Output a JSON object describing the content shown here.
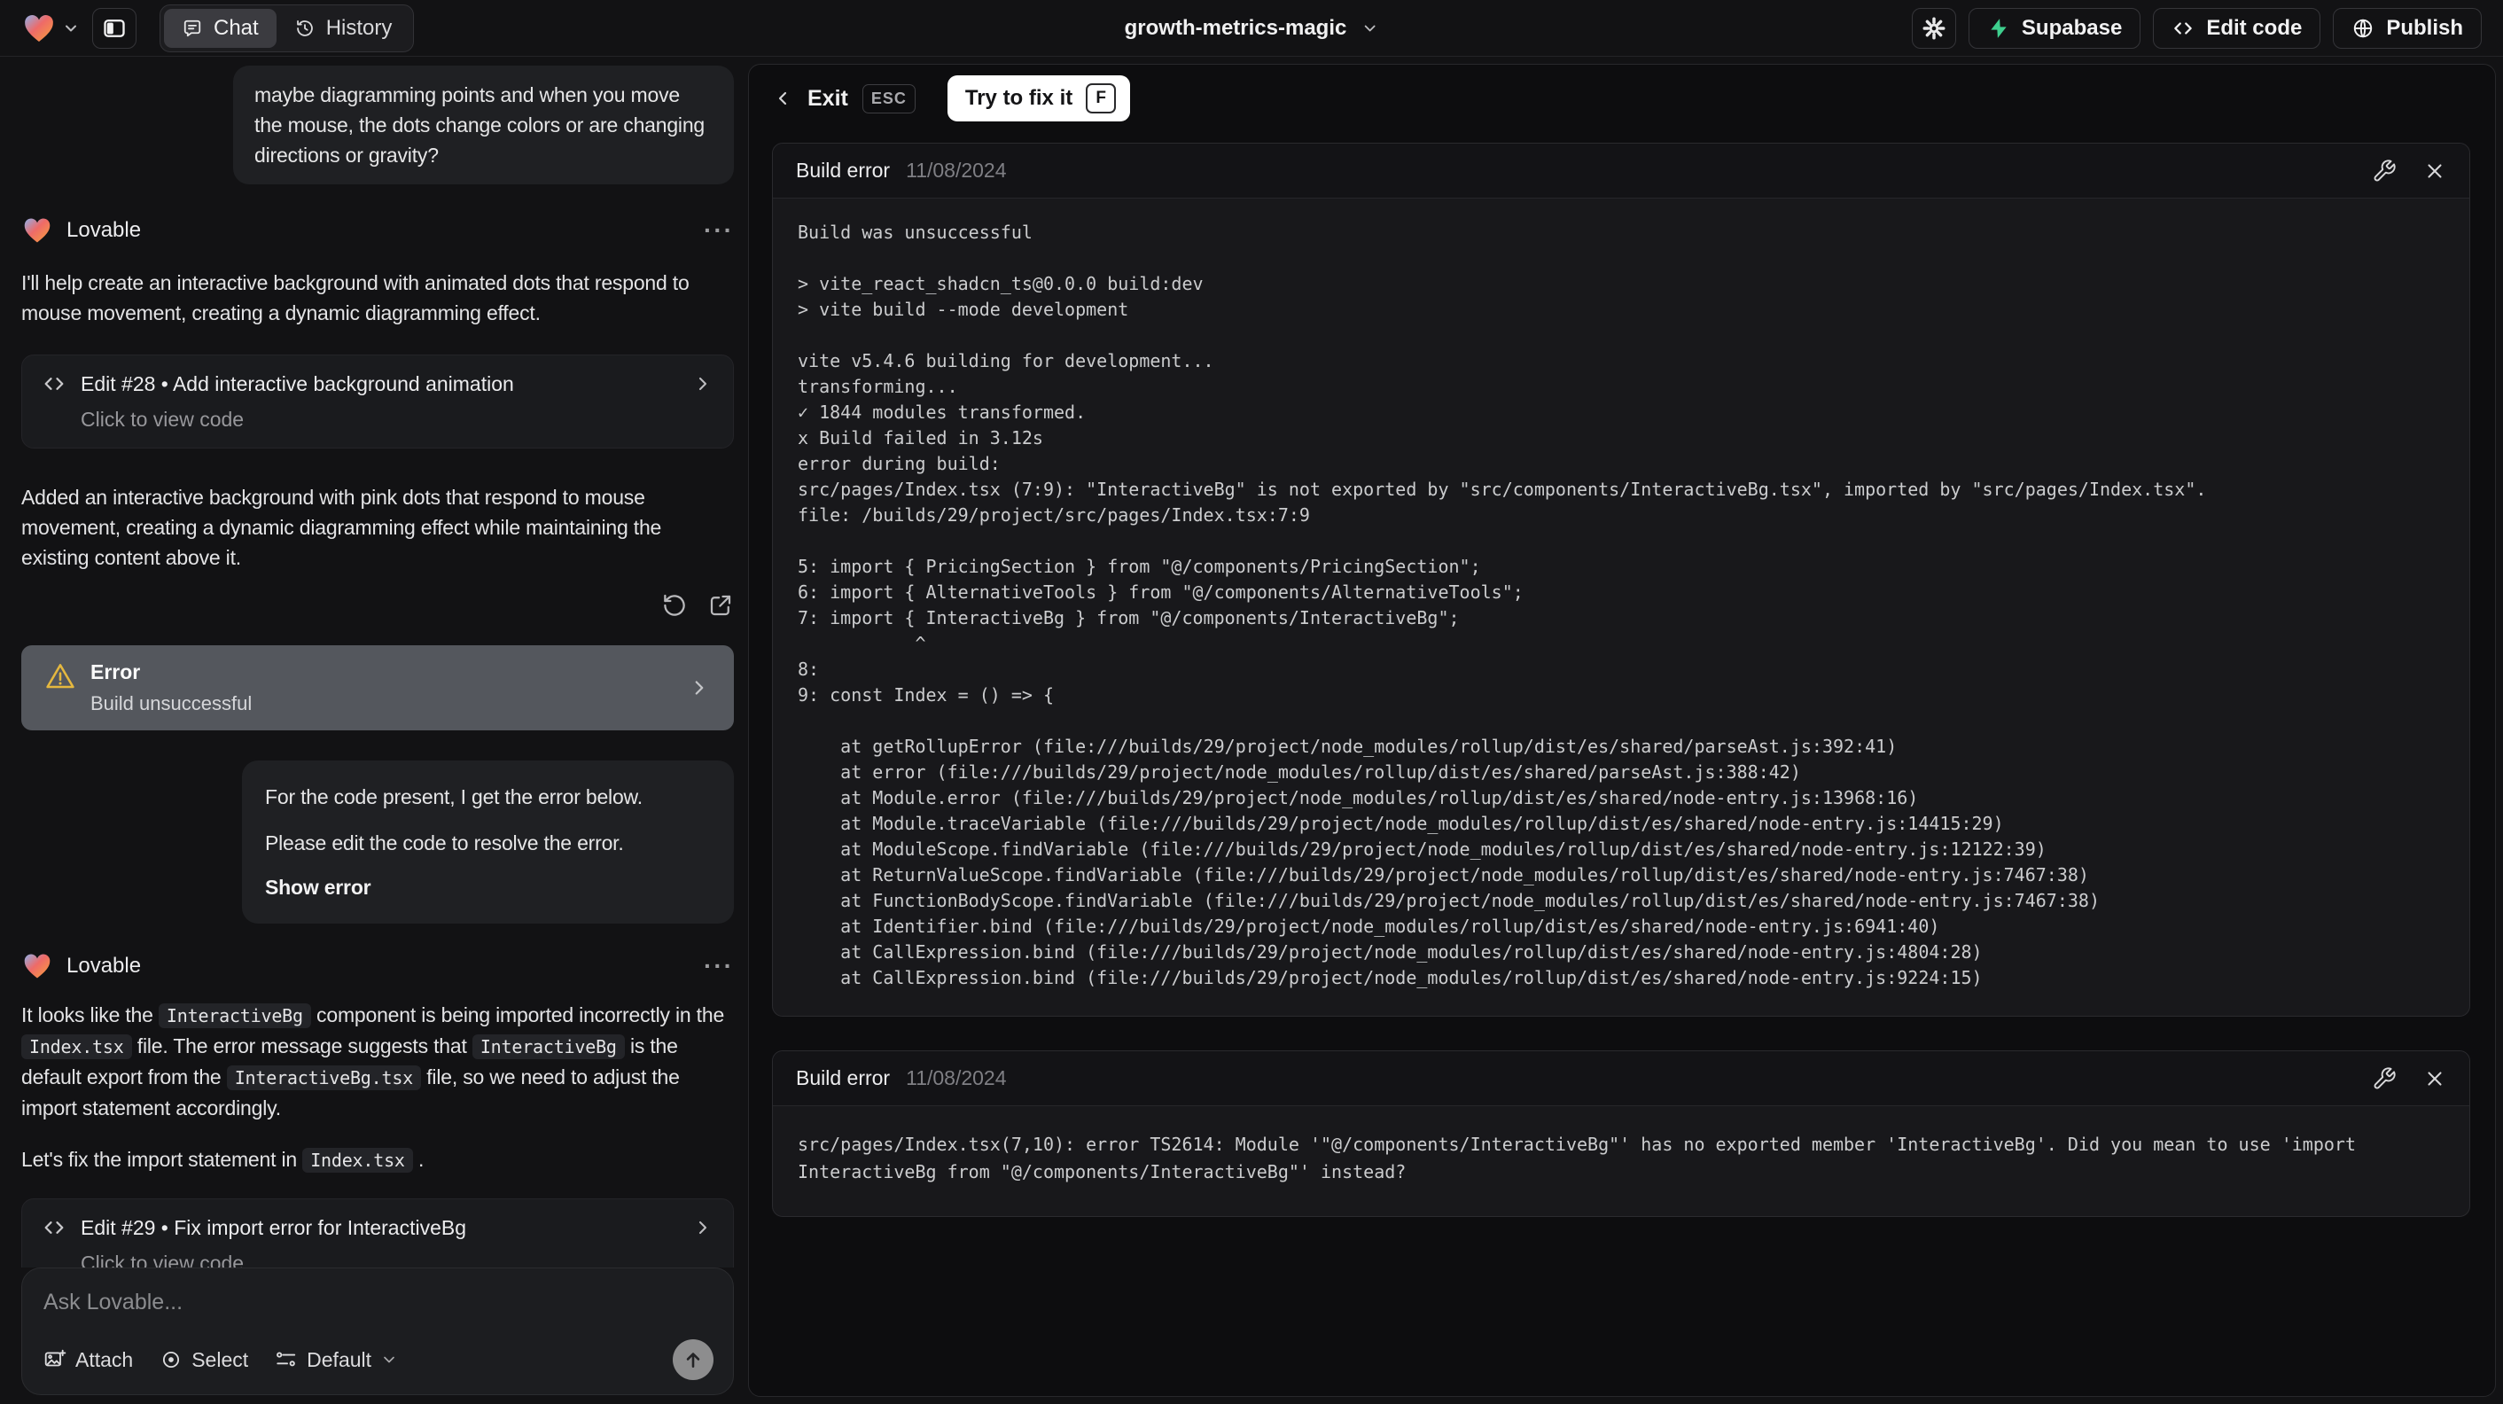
{
  "topbar": {
    "tabs": {
      "chat": "Chat",
      "history": "History"
    },
    "project_name": "growth-metrics-magic",
    "supabase_label": "Supabase",
    "edit_code_label": "Edit code",
    "publish_label": "Publish"
  },
  "ui": {
    "more_glyph": "···"
  },
  "chat": {
    "assistant_name": "Lovable",
    "user_msg1": "maybe diagramming points and when you move the mouse, the dots change colors or are changing directions or gravity?",
    "reply1_p1": "I'll help create an interactive background with animated dots that respond to mouse movement, creating a dynamic diagramming effect.",
    "edit28": {
      "title": "Edit #28 • Add interactive background animation",
      "subtitle": "Click to view code"
    },
    "reply1_p2": "Added an interactive background with pink dots that respond to mouse movement, creating a dynamic diagramming effect while maintaining the existing content above it.",
    "error_status": {
      "title": "Error",
      "subtitle": "Build unsuccessful"
    },
    "user_msg2": {
      "line1": "For the code present, I get the error below.",
      "line2": "Please edit the code to resolve the error.",
      "action": "Show error"
    },
    "reply2": {
      "s0": "It looks like the ",
      "c0": "InteractiveBg",
      "s1": " component is being imported incorrectly in the ",
      "c1": "Index.tsx",
      "s2": " file. The error message suggests that ",
      "c2": "InteractiveBg",
      "s3": " is the default export from the ",
      "c3": "InteractiveBg.tsx",
      "s4": " file, so we need to adjust the import statement accordingly."
    },
    "reply2b": {
      "s0": "Let's fix the import statement in ",
      "c0": "Index.tsx",
      "s1": " ."
    },
    "edit29": {
      "title": "Edit #29 • Fix import error for InteractiveBg",
      "subtitle": "Click to view code"
    },
    "composer": {
      "placeholder": "Ask Lovable...",
      "attach_label": "Attach",
      "select_label": "Select",
      "model_label": "Default"
    }
  },
  "preview": {
    "exit_label": "Exit",
    "esc_label": "ESC",
    "fix_label": "Try to fix it",
    "fix_key": "F",
    "errors": [
      {
        "title": "Build error",
        "date": "11/08/2024",
        "log": "Build was unsuccessful\n\n> vite_react_shadcn_ts@0.0.0 build:dev\n> vite build --mode development\n\nvite v5.4.6 building for development...\ntransforming...\n✓ 1844 modules transformed.\nx Build failed in 3.12s\nerror during build:\nsrc/pages/Index.tsx (7:9): \"InteractiveBg\" is not exported by \"src/components/InteractiveBg.tsx\", imported by \"src/pages/Index.tsx\".\nfile: /builds/29/project/src/pages/Index.tsx:7:9\n\n5: import { PricingSection } from \"@/components/PricingSection\";\n6: import { AlternativeTools } from \"@/components/AlternativeTools\";\n7: import { InteractiveBg } from \"@/components/InteractiveBg\";\n           ^\n8:\n9: const Index = () => {\n\n    at getRollupError (file:///builds/29/project/node_modules/rollup/dist/es/shared/parseAst.js:392:41)\n    at error (file:///builds/29/project/node_modules/rollup/dist/es/shared/parseAst.js:388:42)\n    at Module.error (file:///builds/29/project/node_modules/rollup/dist/es/shared/node-entry.js:13968:16)\n    at Module.traceVariable (file:///builds/29/project/node_modules/rollup/dist/es/shared/node-entry.js:14415:29)\n    at ModuleScope.findVariable (file:///builds/29/project/node_modules/rollup/dist/es/shared/node-entry.js:12122:39)\n    at ReturnValueScope.findVariable (file:///builds/29/project/node_modules/rollup/dist/es/shared/node-entry.js:7467:38)\n    at FunctionBodyScope.findVariable (file:///builds/29/project/node_modules/rollup/dist/es/shared/node-entry.js:7467:38)\n    at Identifier.bind (file:///builds/29/project/node_modules/rollup/dist/es/shared/node-entry.js:6941:40)\n    at CallExpression.bind (file:///builds/29/project/node_modules/rollup/dist/es/shared/node-entry.js:4804:28)\n    at CallExpression.bind (file:///builds/29/project/node_modules/rollup/dist/es/shared/node-entry.js:9224:15)"
      },
      {
        "title": "Build error",
        "date": "11/08/2024",
        "log": "src/pages/Index.tsx(7,10): error TS2614: Module '\"@/components/InteractiveBg\"' has no exported member 'InteractiveBg'. Did you mean to use 'import InteractiveBg from \"@/components/InteractiveBg\"' instead?"
      }
    ]
  }
}
